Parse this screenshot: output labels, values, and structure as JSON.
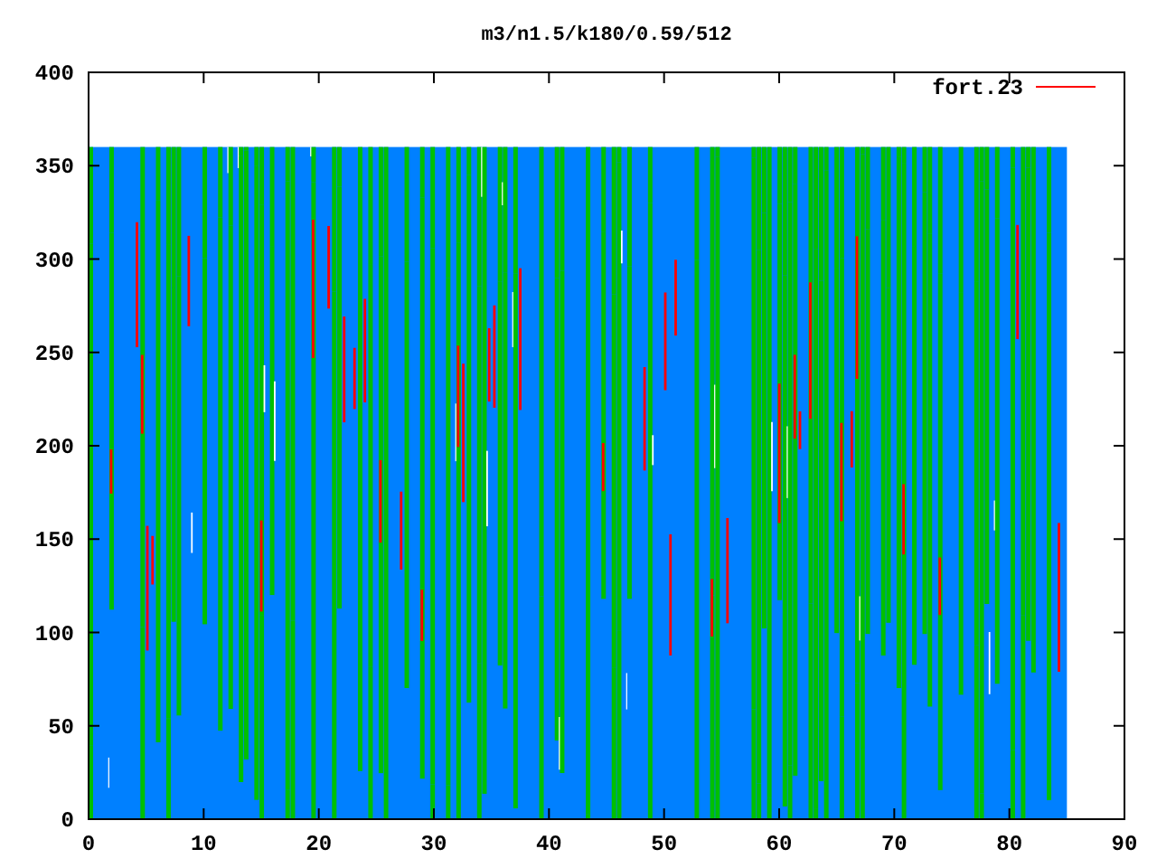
{
  "plot": {
    "title": "m3/n1.5/k180/0.59/512",
    "y_ticks": [
      "400",
      "350",
      "300",
      "250",
      "200",
      "150",
      "100",
      "50",
      "0"
    ],
    "x_ticks": [
      "0",
      "10",
      "20",
      "30",
      "40",
      "50",
      "60",
      "70",
      "80",
      "90"
    ],
    "legend": {
      "label": "fort.23"
    }
  }
}
